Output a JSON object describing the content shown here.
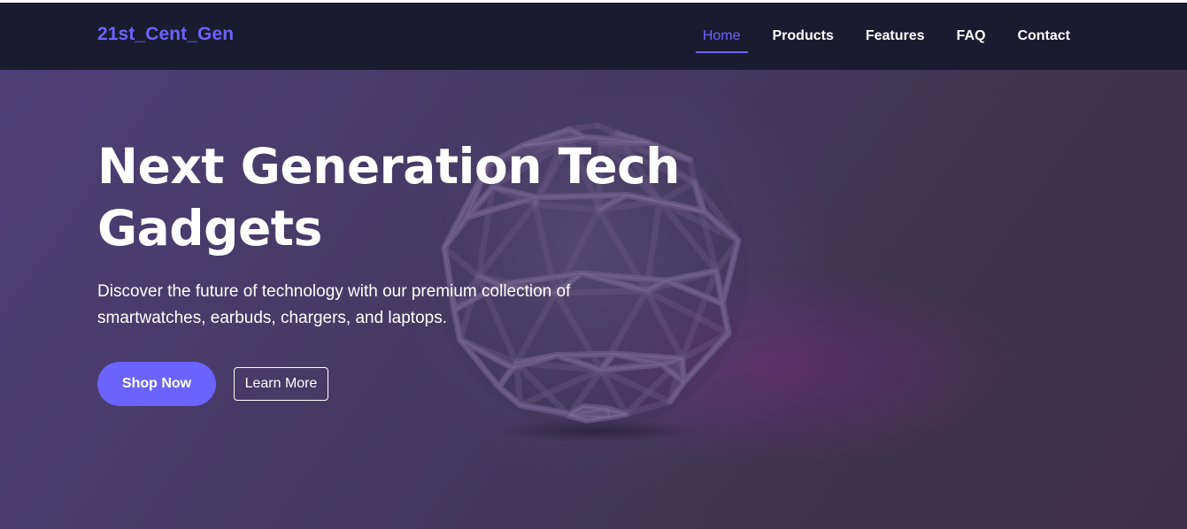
{
  "navbar": {
    "brand": "21st_Cent_Gen",
    "links": [
      {
        "label": "Home",
        "active": true
      },
      {
        "label": "Products",
        "active": false
      },
      {
        "label": "Features",
        "active": false
      },
      {
        "label": "FAQ",
        "active": false
      },
      {
        "label": "Contact",
        "active": false
      }
    ]
  },
  "hero": {
    "title_line1": "Next Generation Tech",
    "title_line2": "Gadgets",
    "subtitle": "Discover the future of technology with our premium collection of smartwatches, earbuds, chargers, and laptops.",
    "primary_button": "Shop Now",
    "secondary_button": "Learn More",
    "background_image": "geodesic-sphere"
  },
  "colors": {
    "accent": "#6c63ff",
    "navbar_bg": "#1b1b2f",
    "hero_bg": "#463a66",
    "text": "#ffffff"
  }
}
